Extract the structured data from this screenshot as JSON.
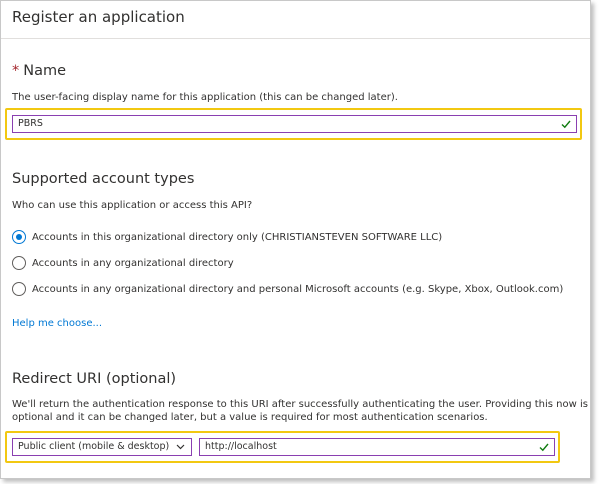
{
  "header": {
    "title": "Register an application"
  },
  "name_section": {
    "required_marker": "*",
    "title": "Name",
    "description": "The user-facing display name for this application (this can be changed later).",
    "value": "PBRS"
  },
  "account_types": {
    "title": "Supported account types",
    "question": "Who can use this application or access this API?",
    "options": [
      {
        "label": "Accounts in this organizational directory only (CHRISTIANSTEVEN SOFTWARE LLC)",
        "selected": true
      },
      {
        "label": "Accounts in any organizational directory",
        "selected": false
      },
      {
        "label": "Accounts in any organizational directory and personal Microsoft accounts (e.g. Skype, Xbox, Outlook.com)",
        "selected": false
      }
    ],
    "help_link": "Help me choose..."
  },
  "redirect": {
    "title": "Redirect URI (optional)",
    "description_line1": "We'll return the authentication response to this URI after successfully authenticating the user. Providing this now is",
    "description_line2": "optional and it can be changed later, but a value is required for most authentication scenarios.",
    "platform_selected": "Public client (mobile & desktop)",
    "uri_value": "http://localhost"
  },
  "colors": {
    "highlight": "#f2c811",
    "accent": "#0078d4",
    "valid_check": "#107c10",
    "required": "#a4262c"
  }
}
